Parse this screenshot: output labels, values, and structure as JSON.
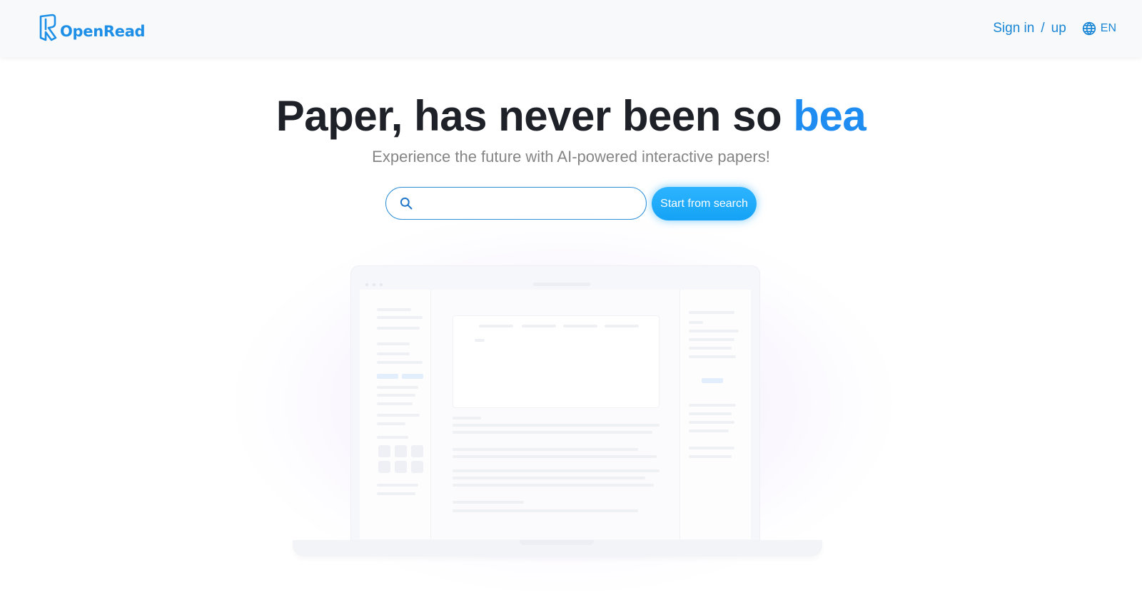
{
  "header": {
    "logo_text": "OpenRead",
    "sign_in_label": "Sign in",
    "separator": "/",
    "sign_up_label": "up",
    "language_label": "EN"
  },
  "hero": {
    "title_main": "Paper, has never been so ",
    "title_accent": "bea",
    "subtitle": "Experience the future with AI-powered interactive papers!"
  },
  "search": {
    "placeholder": "",
    "value": "",
    "button_label": "Start from search"
  },
  "colors": {
    "brand_blue": "#1e8cf0",
    "button_blue": "#15a2f5",
    "title_dark": "#1f2129",
    "subtitle_gray": "#858585"
  },
  "icons": {
    "logo": "openread-logo-icon",
    "search": "search-icon",
    "language": "globe-icon"
  }
}
